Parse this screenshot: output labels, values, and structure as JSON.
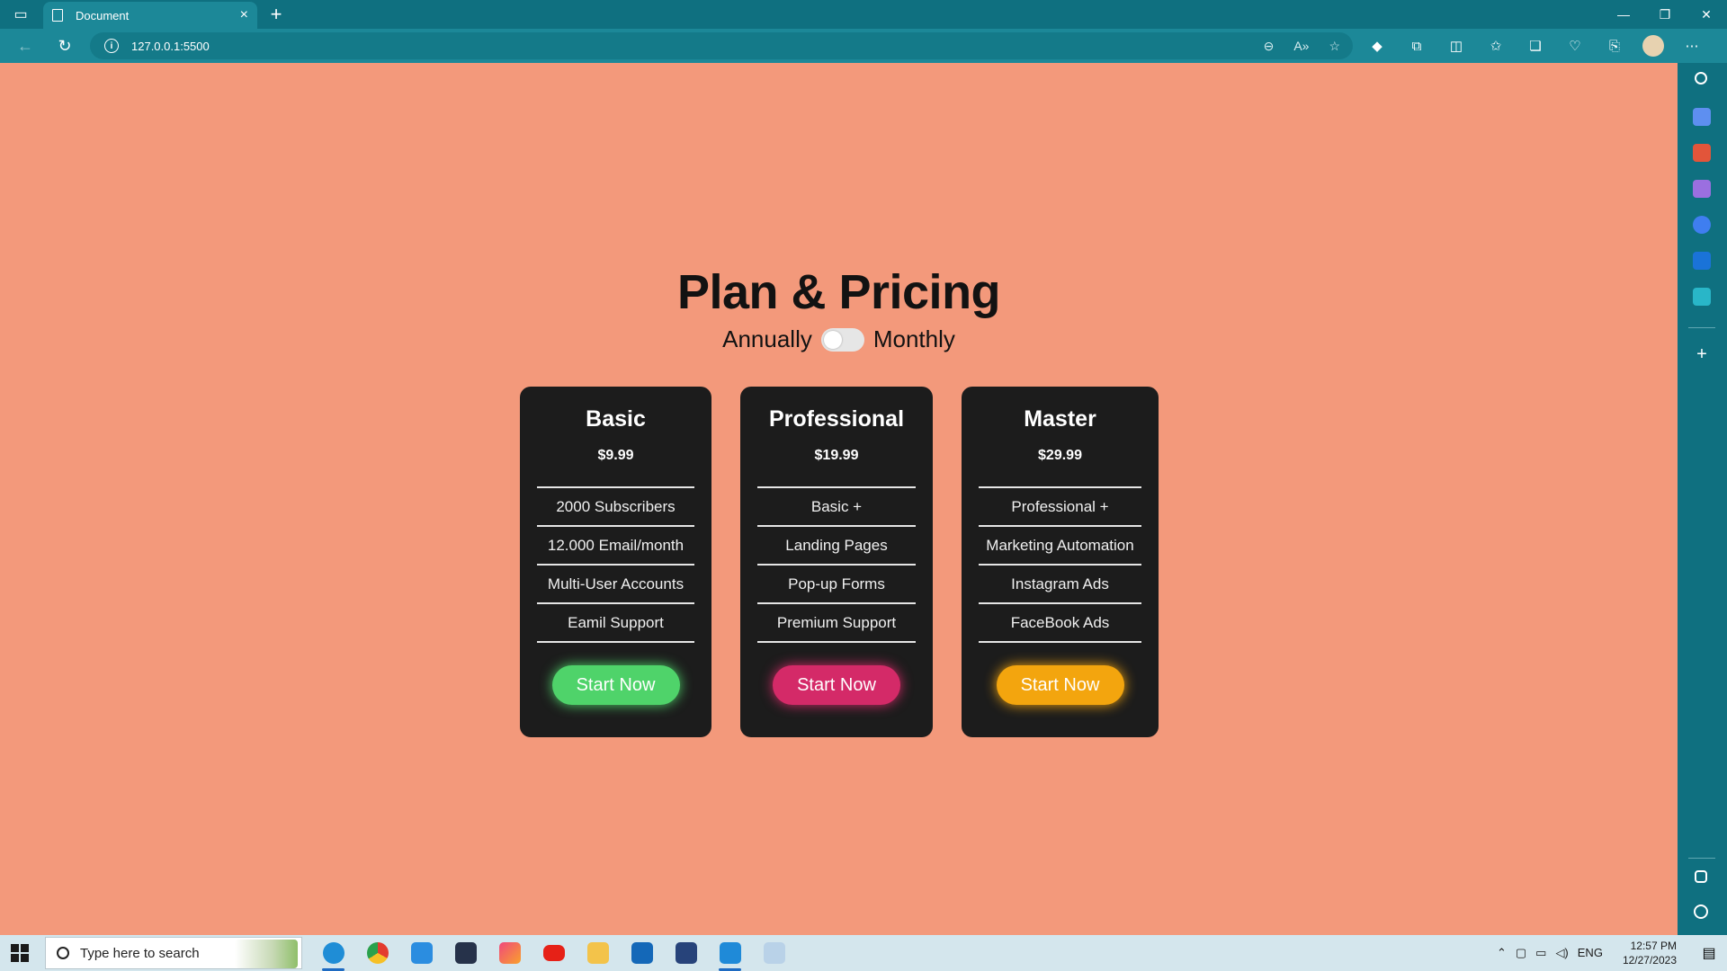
{
  "browser": {
    "tab_title": "Document",
    "tab_close": "×",
    "new_tab": "+",
    "address": "127.0.0.1:5500",
    "window_controls": {
      "minimize": "—",
      "restore": "❐",
      "close": "✕"
    }
  },
  "page": {
    "title": "Plan & Pricing",
    "billing_left": "Annually",
    "billing_right": "Monthly",
    "toggle_state": "annually"
  },
  "plans": [
    {
      "name": "Basic",
      "price": "$9.99",
      "features": [
        "2000 Subscribers",
        "12.000 Email/month",
        "Multi-User Accounts",
        "Eamil Support"
      ],
      "cta": "Start Now",
      "accent": "#4fd36a"
    },
    {
      "name": "Professional",
      "price": "$19.99",
      "features": [
        "Basic +",
        "Landing Pages",
        "Pop-up Forms",
        "Premium Support"
      ],
      "cta": "Start Now",
      "accent": "#d42a68"
    },
    {
      "name": "Master",
      "price": "$29.99",
      "features": [
        "Professional +",
        "Marketing Automation",
        "Instagram Ads",
        "FaceBook Ads"
      ],
      "cta": "Start Now",
      "accent": "#f3a50e"
    }
  ],
  "taskbar": {
    "search_placeholder": "Type here to search",
    "time": "12:57 PM",
    "date": "12/27/2023",
    "language": "ENG"
  },
  "colors": {
    "page_background": "#f3997b",
    "card_background": "#1c1c1c",
    "browser_chrome": "#0f7080"
  }
}
